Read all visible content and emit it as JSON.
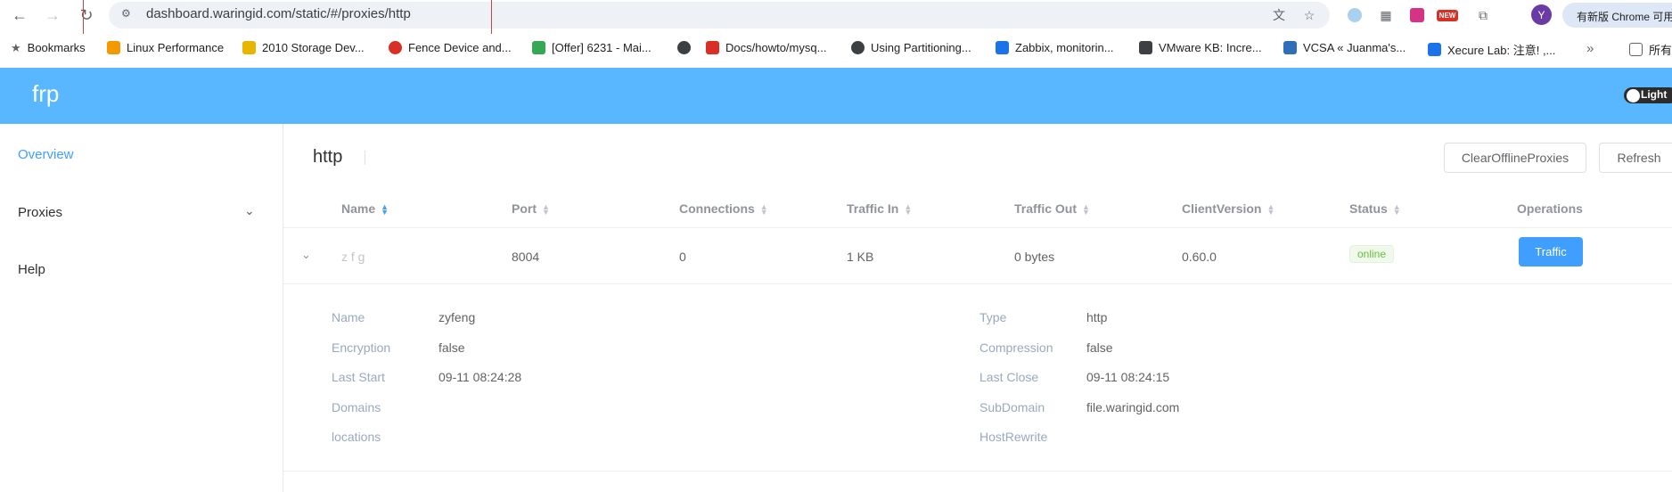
{
  "browser": {
    "url": "dashboard.waringid.com/static/#/proxies/http",
    "profile_initial": "Y",
    "update_label": "有新版 Chrome 可用",
    "new_badge": "NEW"
  },
  "bookmarks": [
    {
      "label": "Bookmarks",
      "color": "#5f6368"
    },
    {
      "label": "Linux Performance",
      "color": "#f29900"
    },
    {
      "label": "2010 Storage Dev...",
      "color": "#e8b500"
    },
    {
      "label": "Fence Device and...",
      "color": "#d93025"
    },
    {
      "label": "[Offer] 6231 - Mai...",
      "color": "#34a853"
    },
    {
      "label": "Docs/howto/mysq...",
      "color": "#3c4043"
    },
    {
      "label": "Docs/howto/mysq...",
      "color": "#d93025"
    },
    {
      "label": "Using Partitioning...",
      "color": "#3c4043"
    },
    {
      "label": "Zabbix, monitorin...",
      "color": "#1a73e8"
    },
    {
      "label": "VMware KB: Incre...",
      "color": "#3c4043"
    },
    {
      "label": "VCSA « Juanma's...",
      "color": "#2f6fba"
    },
    {
      "label": "Xecure Lab: 注意! ,...",
      "color": "#1a73e8"
    },
    {
      "label": "所有",
      "color": "#5f6368"
    }
  ],
  "app": {
    "logo": "frp",
    "theme_label": "Light",
    "sidebar": {
      "overview": "Overview",
      "proxies": "Proxies",
      "help": "Help"
    },
    "page_title": "http",
    "buttons": {
      "clear_offline": "ClearOfflineProxies",
      "refresh": "Refresh"
    },
    "table": {
      "headers": [
        "Name",
        "Port",
        "Connections",
        "Traffic In",
        "Traffic Out",
        "ClientVersion",
        "Status",
        "Operations"
      ],
      "row": {
        "name": "z f  g",
        "port": "8004",
        "connections": "0",
        "traffic_in": "1 KB",
        "traffic_out": "0 bytes",
        "client_version": "0.60.0",
        "status": "online",
        "operation": "Traffic"
      }
    },
    "details": {
      "left": [
        {
          "label": "Name",
          "value": "zyfeng"
        },
        {
          "label": "Encryption",
          "value": "false"
        },
        {
          "label": "Last Start",
          "value": "09-11 08:24:28"
        },
        {
          "label": "Domains",
          "value": ""
        },
        {
          "label": "locations",
          "value": ""
        }
      ],
      "right": [
        {
          "label": "Type",
          "value": "http"
        },
        {
          "label": "Compression",
          "value": "false"
        },
        {
          "label": "Last Close",
          "value": "09-11 08:24:15"
        },
        {
          "label": "SubDomain",
          "value": "file.waringid.com"
        },
        {
          "label": "HostRewrite",
          "value": ""
        }
      ]
    }
  },
  "colors": {
    "header": "#58b7ff",
    "accent": "#409eff",
    "online": "#67c23a"
  }
}
